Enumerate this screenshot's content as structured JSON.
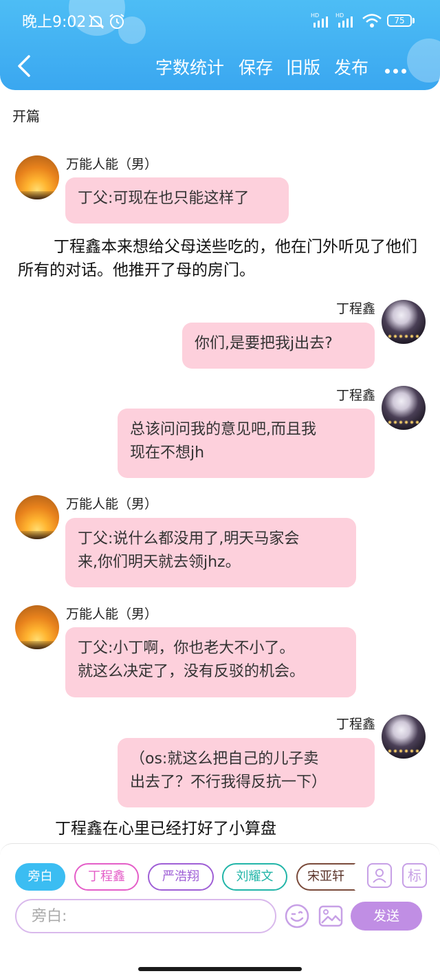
{
  "status_bar": {
    "time": "晚上9:02",
    "battery": "75",
    "signal_label": "HD"
  },
  "header": {
    "actions": [
      "字数统计",
      "保存",
      "旧版",
      "发布"
    ],
    "colors": {
      "header_bg": "#3aa7f0",
      "bubble_bg": "#fdd0dc"
    }
  },
  "chapter": {
    "title": "开篇"
  },
  "messages": [
    {
      "side": "left",
      "name": "万能人能（男）",
      "text": "丁父:可现在也只能这样了",
      "avatar": "sunset-avatar"
    },
    {
      "side": "narration",
      "text": "丁程鑫本来想给父母送些吃的，他在门外听见了他们所有的对话。他推开了母的房门。"
    },
    {
      "side": "right",
      "name": "丁程鑫",
      "text": "你们,是要把我j出去?",
      "avatar": "night-photo-avatar"
    },
    {
      "side": "right",
      "name": "丁程鑫",
      "text_lines": [
        "总该问问我的意见吧,而且我",
        "现在不想jh"
      ],
      "avatar": "night-photo-avatar"
    },
    {
      "side": "left",
      "name": "万能人能（男）",
      "text_lines": [
        "丁父:说什么都没用了,明天马家会",
        "来,你们明天就去领jhz。"
      ],
      "avatar": "sunset-avatar"
    },
    {
      "side": "left",
      "name": "万能人能（男）",
      "text_lines": [
        "丁父:小丁啊，你也老大不小了。",
        "就这么决定了，没有反驳的机会。"
      ],
      "avatar": "sunset-avatar"
    },
    {
      "side": "right",
      "name": "丁程鑫",
      "text_lines": [
        "（os:就这么把自己的儿子卖",
        "出去了？不行我得反抗一下）"
      ],
      "avatar": "night-photo-avatar"
    },
    {
      "side": "narration",
      "text": "丁程鑫在心里已经打好了小算盘"
    }
  ],
  "input_panel": {
    "roles": [
      {
        "label": "旁白",
        "color": "#3bbdf2",
        "selected": true
      },
      {
        "label": "丁程鑫",
        "color": "#e45ec8",
        "selected": false
      },
      {
        "label": "严浩翔",
        "color": "#9f5fd6",
        "selected": false
      },
      {
        "label": "刘耀文",
        "color": "#22b5a8",
        "selected": false
      },
      {
        "label": "宋亚轩",
        "color": "#7a4a3a",
        "selected": false
      }
    ],
    "tag_label": "标",
    "placeholder": "旁白:",
    "send_label": "发送",
    "icons": [
      "character-manage-icon",
      "emoji-icon",
      "image-icon"
    ]
  }
}
